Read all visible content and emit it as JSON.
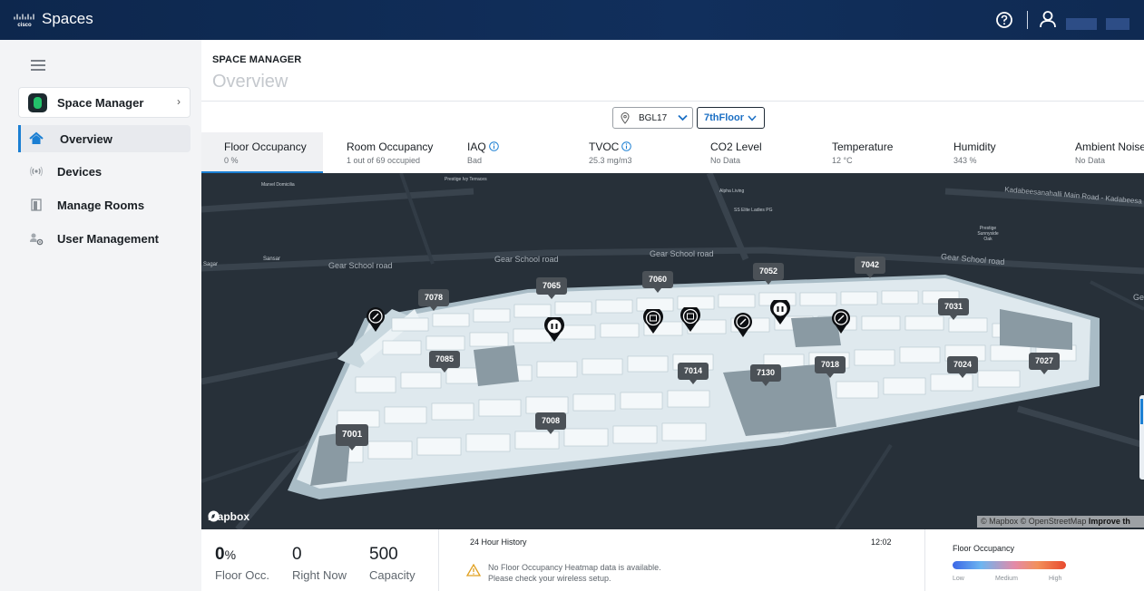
{
  "topbar": {
    "brand": "cisco",
    "app_title": "Spaces",
    "icons": [
      "help-icon",
      "user-icon"
    ]
  },
  "sidebar": {
    "app_card": {
      "label": "Space Manager",
      "chevron": "›"
    },
    "items": [
      {
        "label": "Overview",
        "icon": "home-icon",
        "active": true
      },
      {
        "label": "Devices",
        "icon": "wireless-icon",
        "active": false
      },
      {
        "label": "Manage Rooms",
        "icon": "door-icon",
        "active": false
      },
      {
        "label": "User Management",
        "icon": "users-gear-icon",
        "active": false
      }
    ]
  },
  "header": {
    "section": "SPACE MANAGER",
    "title": "Overview"
  },
  "filters": {
    "building": "BGL17",
    "floor": "7thFloor"
  },
  "metrics": [
    {
      "label": "Floor Occupancy",
      "value": "0 %",
      "info": false,
      "active": true
    },
    {
      "label": "Room Occupancy",
      "value": "1 out of 69 occupied",
      "info": false,
      "active": false
    },
    {
      "label": "IAQ",
      "value": "Bad",
      "info": true,
      "active": false
    },
    {
      "label": "TVOC",
      "value": "25.3 mg/m3",
      "info": true,
      "active": false
    },
    {
      "label": "CO2 Level",
      "value": "No Data",
      "info": false,
      "active": false
    },
    {
      "label": "Temperature",
      "value": "12 °C",
      "info": false,
      "active": false
    },
    {
      "label": "Humidity",
      "value": "343 %",
      "info": false,
      "active": false
    },
    {
      "label": "Ambient Noise",
      "value": "No Data",
      "info": false,
      "active": false
    }
  ],
  "map": {
    "places": [
      "Marvel Domicilia",
      "Prestige Ivy Terraces",
      "Alpha Living",
      "SS Elite Ladies PG",
      "Prestige Sunnyside Oak",
      "Sagar",
      "Sansar"
    ],
    "roads": [
      "Gear School road",
      "Gear School road",
      "Gear School road",
      "Gear School road",
      "Kadabeesanahalli Main Road - Kadabeesa",
      "Ge"
    ],
    "rooms": [
      "7078",
      "7065",
      "7060",
      "7052",
      "7042",
      "7031",
      "7085",
      "7014",
      "7130",
      "7018",
      "7024",
      "7027",
      "7008",
      "7001"
    ],
    "mapbox_label": "mapbox",
    "attribution": "© Mapbox © OpenStreetMap",
    "attribution_link": "Improve th"
  },
  "summary": {
    "floor_occ_value": "0",
    "floor_occ_unit": "%",
    "floor_occ_label": "Floor Occ.",
    "right_now_value": "0",
    "right_now_label": "Right Now",
    "capacity_value": "500",
    "capacity_label": "Capacity"
  },
  "history": {
    "title": "24 Hour History",
    "time": "12:02",
    "warning_line1": "No Floor Occupancy Heatmap data is available.",
    "warning_line2": "Please check your wireless setup."
  },
  "legend": {
    "title": "Floor Occupancy",
    "low": "Low",
    "medium": "Medium",
    "high": "High"
  }
}
